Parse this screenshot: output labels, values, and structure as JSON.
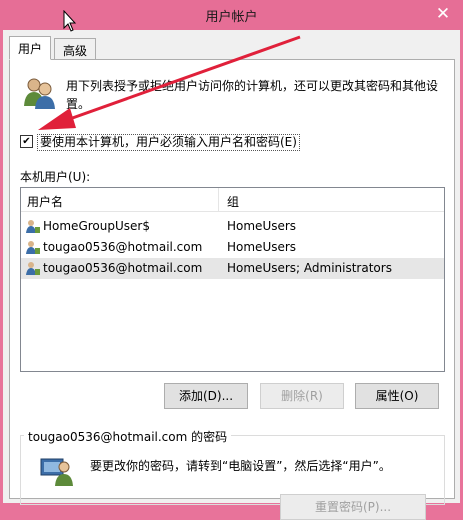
{
  "window": {
    "title": "用户帐户",
    "close_glyph": "✕"
  },
  "tabs": [
    {
      "label": "用户"
    },
    {
      "label": "高级"
    }
  ],
  "description": "用下列表授予或拒绝用户访问你的计算机，还可以更改其密码和其他设置。",
  "require_login": {
    "label": "要使用本计算机，用户必须输入用户名和密码(E)",
    "checked": true,
    "check_glyph": "✔"
  },
  "local_users": {
    "label": "本机用户(U):",
    "columns": [
      "用户名",
      "组"
    ],
    "rows": [
      {
        "name": "HomeGroupUser$",
        "group": "HomeUsers"
      },
      {
        "name": "tougao0536@hotmail.com",
        "group": "HomeUsers"
      },
      {
        "name": "tougao0536@hotmail.com",
        "group": "HomeUsers; Administrators"
      }
    ]
  },
  "buttons": {
    "add": "添加(D)...",
    "remove": "删除(R)",
    "properties": "属性(O)"
  },
  "password_group": {
    "title": "tougao0536@hotmail.com 的密码",
    "text": "要更改你的密码，请转到“电脑设置”，然后选择“用户”。",
    "reset_button": "重置密码(P)..."
  },
  "colors": {
    "titlebar": "#e66e96",
    "annotation_arrow": "#e0203a",
    "selected_row": "#e6e6e6"
  },
  "icons": {
    "users": "users-icon",
    "user_row": "user-icon",
    "password_user": "password-user-icon",
    "cursor": "mouse-cursor-icon"
  }
}
